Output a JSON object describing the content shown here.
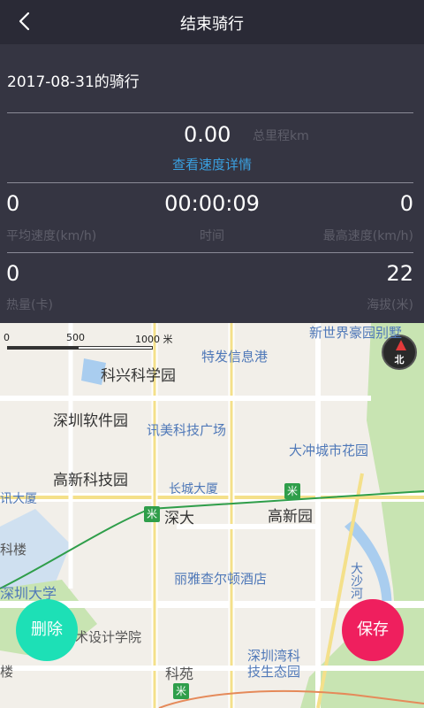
{
  "header": {
    "title": "结束骑行",
    "back_icon": "chevron-left-icon"
  },
  "ride": {
    "date_label": "2017-08-31的骑行"
  },
  "distance": {
    "value": "0.00",
    "label": "总里程km",
    "speed_link": "查看速度详情"
  },
  "stats_row1": {
    "avg_speed_value": "0",
    "avg_speed_label": "平均速度(km/h)",
    "time_value": "00:00:09",
    "time_label": "时间",
    "max_speed_value": "0",
    "max_speed_label": "最高速度(km/h)"
  },
  "stats_row2": {
    "calories_value": "0",
    "calories_label": "热量(卡)",
    "altitude_value": "22",
    "altitude_label": "海拔(米)"
  },
  "map": {
    "scale": {
      "zero": "0",
      "mid": "500",
      "max": "1000 米"
    },
    "compass_label": "北",
    "metro_icon": "米",
    "places": {
      "p1": "新世界豪园别墅",
      "p2": "特发信息港",
      "p3": "科兴科学园",
      "p4": "深圳软件园",
      "p5": "讯美科技广场",
      "p6": "大冲城市花园",
      "p7": "高新科技园",
      "p8": "长城大厦",
      "p9": "讯大厦",
      "p10": "深大",
      "p11": "高新园",
      "p12": "科楼",
      "p13": "丽雅查尔顿酒店",
      "p14": "大沙河",
      "p15": "深圳大学",
      "p16": "术设计学院",
      "p17": "深圳湾科技生态园",
      "p18": "科苑",
      "p19": "楼"
    }
  },
  "actions": {
    "delete_label": "删除",
    "save_label": "保存"
  },
  "colors": {
    "accent_link": "#3aa0e0",
    "delete": "#1de0b6",
    "save": "#ef1f5e",
    "header": "#2a2a36",
    "panel": "#353542"
  }
}
